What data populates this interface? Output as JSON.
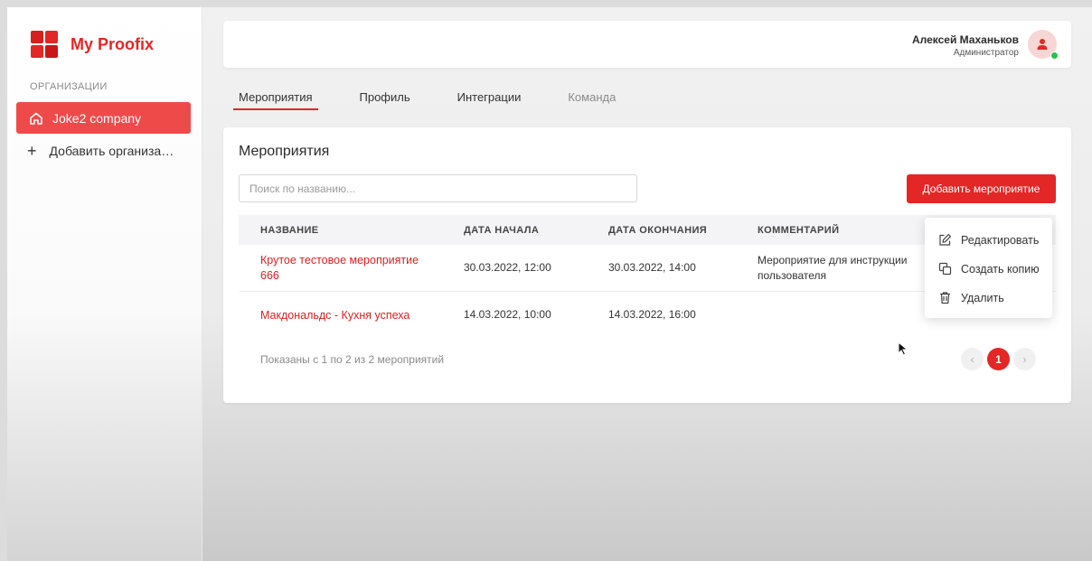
{
  "app": {
    "name": "My Proofix",
    "brand_color": "#e32626"
  },
  "sidebar": {
    "heading": "ОРГАНИЗАЦИИ",
    "active_org": {
      "label": "Joke2 company",
      "icon": "home-icon"
    },
    "add_org": {
      "label": "Добавить организа…",
      "icon": "plus-icon"
    }
  },
  "header": {
    "user_name": "Алексей Маханьков",
    "user_role": "Администратор",
    "avatar_icon": "user-icon",
    "status_color": "#2cbf4e"
  },
  "tabs": [
    {
      "label": "Мероприятия",
      "active": true
    },
    {
      "label": "Профиль"
    },
    {
      "label": "Интеграции"
    },
    {
      "label": "Команда"
    }
  ],
  "events": {
    "title": "Мероприятия",
    "search_placeholder": "Поиск по названию...",
    "add_button": "Добавить мероприятие",
    "columns": [
      "НАЗВАНИЕ",
      "ДАТА НАЧАЛА",
      "ДАТА ОКОНЧАНИЯ",
      "КОММЕНТАРИЙ"
    ],
    "rows": [
      {
        "name": "Крутое тестовое мероприятие 666",
        "start": "30.03.2022, 12:00",
        "end": "30.03.2022, 14:00",
        "comment": "Мероприятие для инструкции пользователя"
      },
      {
        "name": "Макдональдс - Кухня успеха",
        "start": "14.03.2022, 10:00",
        "end": "14.03.2022, 16:00",
        "comment": ""
      }
    ],
    "footer": "Показаны с 1 по 2 из 2 мероприятий",
    "pagination": {
      "prev": "‹",
      "current": "1",
      "next": "›"
    }
  },
  "context_menu": [
    {
      "label": "Редактировать",
      "icon": "edit-icon"
    },
    {
      "label": "Создать копию",
      "icon": "copy-icon"
    },
    {
      "label": "Удалить",
      "icon": "trash-icon"
    }
  ]
}
